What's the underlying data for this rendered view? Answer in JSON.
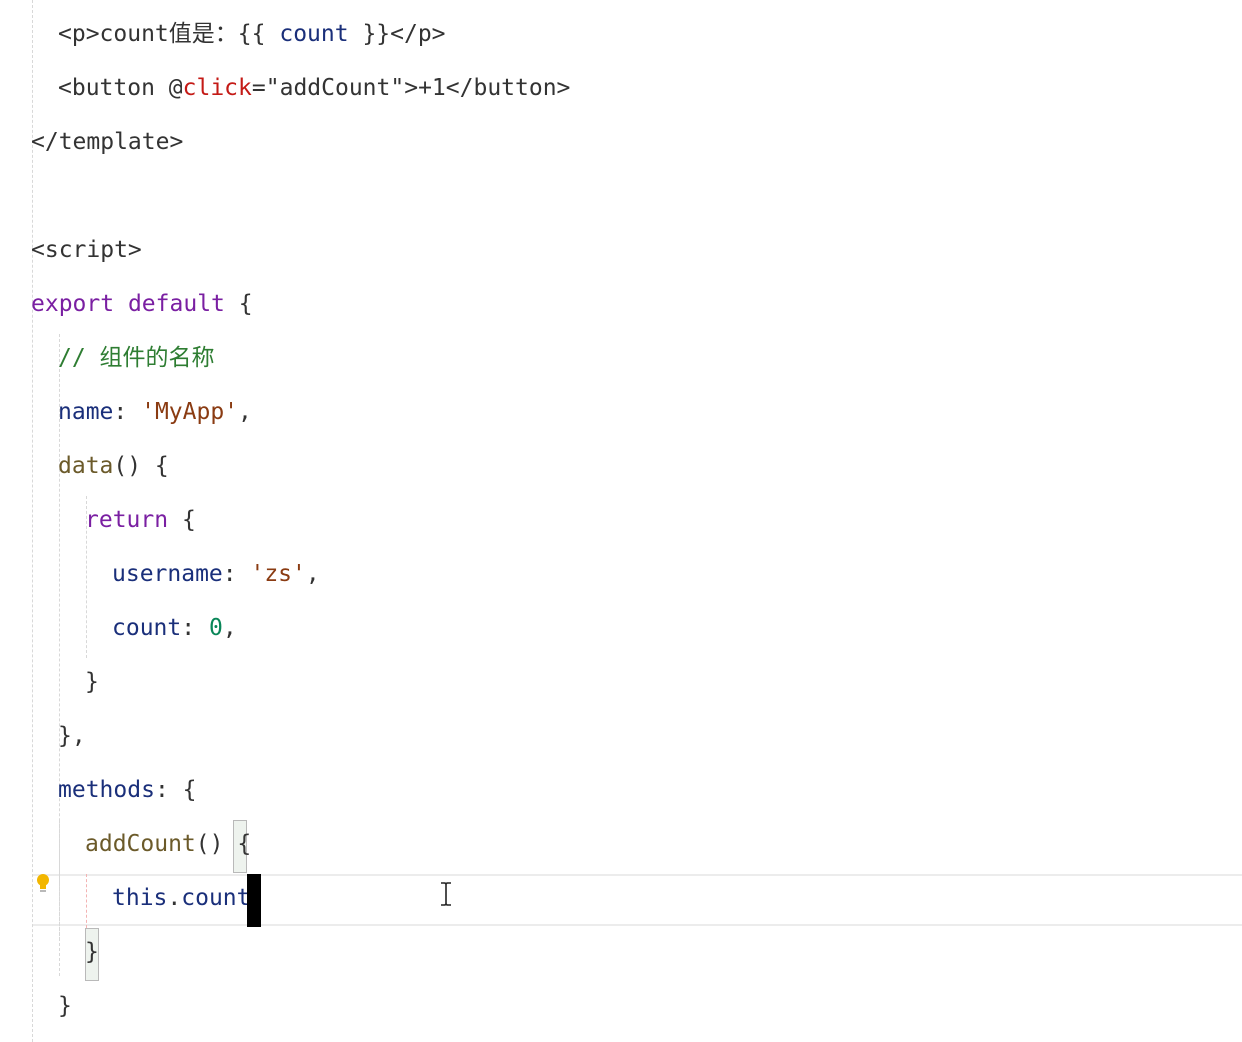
{
  "editor": {
    "language": "vue",
    "cursor": {
      "line": 17,
      "after_text": "this.count"
    },
    "lines": [
      {
        "indent": 1,
        "tokens": [
          {
            "t": "<p>",
            "c": "tag"
          },
          {
            "t": "count值是：",
            "c": "text"
          },
          {
            "t": "{{ ",
            "c": "text"
          },
          {
            "t": "count",
            "c": "var"
          },
          {
            "t": " }}",
            "c": "text"
          },
          {
            "t": "</p>",
            "c": "tag"
          }
        ]
      },
      {
        "indent": 1,
        "tokens": [
          {
            "t": "<button ",
            "c": "tag"
          },
          {
            "t": "@",
            "c": "text"
          },
          {
            "t": "click",
            "c": "attr"
          },
          {
            "t": "=",
            "c": "text"
          },
          {
            "t": "\"addCount\"",
            "c": "str"
          },
          {
            "t": ">+1",
            "c": "text"
          },
          {
            "t": "</button>",
            "c": "tag"
          }
        ]
      },
      {
        "indent": 0,
        "tokens": [
          {
            "t": "</template>",
            "c": "tag"
          }
        ]
      },
      {
        "indent": 0,
        "tokens": []
      },
      {
        "indent": 0,
        "tokens": [
          {
            "t": "<script>",
            "c": "tag"
          }
        ]
      },
      {
        "indent": 0,
        "tokens": [
          {
            "t": "export",
            "c": "kw"
          },
          {
            "t": " ",
            "c": "punc"
          },
          {
            "t": "default",
            "c": "kw"
          },
          {
            "t": " {",
            "c": "punc"
          }
        ]
      },
      {
        "indent": 1,
        "tokens": [
          {
            "t": "// 组件的名称",
            "c": "comment"
          }
        ]
      },
      {
        "indent": 1,
        "tokens": [
          {
            "t": "name",
            "c": "prop"
          },
          {
            "t": ": ",
            "c": "punc"
          },
          {
            "t": "'MyApp'",
            "c": "jsstr"
          },
          {
            "t": ",",
            "c": "punc"
          }
        ]
      },
      {
        "indent": 1,
        "tokens": [
          {
            "t": "data",
            "c": "fn"
          },
          {
            "t": "() {",
            "c": "punc"
          }
        ]
      },
      {
        "indent": 2,
        "tokens": [
          {
            "t": "return",
            "c": "kw"
          },
          {
            "t": " {",
            "c": "punc"
          }
        ]
      },
      {
        "indent": 3,
        "tokens": [
          {
            "t": "username",
            "c": "prop"
          },
          {
            "t": ": ",
            "c": "punc"
          },
          {
            "t": "'zs'",
            "c": "jsstr"
          },
          {
            "t": ",",
            "c": "punc"
          }
        ]
      },
      {
        "indent": 3,
        "tokens": [
          {
            "t": "count",
            "c": "prop"
          },
          {
            "t": ": ",
            "c": "punc"
          },
          {
            "t": "0",
            "c": "num"
          },
          {
            "t": ",",
            "c": "punc"
          }
        ]
      },
      {
        "indent": 2,
        "tokens": [
          {
            "t": "}",
            "c": "punc"
          }
        ]
      },
      {
        "indent": 1,
        "tokens": [
          {
            "t": "},",
            "c": "punc"
          }
        ]
      },
      {
        "indent": 1,
        "tokens": [
          {
            "t": "methods",
            "c": "prop"
          },
          {
            "t": ": {",
            "c": "punc"
          }
        ]
      },
      {
        "indent": 2,
        "tokens": [
          {
            "t": "addCount",
            "c": "fn"
          },
          {
            "t": "() ",
            "c": "punc"
          },
          {
            "t": "{",
            "c": "punc"
          }
        ]
      },
      {
        "indent": 3,
        "tokens": [
          {
            "t": "this",
            "c": "var"
          },
          {
            "t": ".",
            "c": "punc"
          },
          {
            "t": "count",
            "c": "var"
          }
        ]
      },
      {
        "indent": 2,
        "tokens": [
          {
            "t": "}",
            "c": "punc"
          }
        ]
      },
      {
        "indent": 1,
        "tokens": [
          {
            "t": "}",
            "c": "punc"
          }
        ]
      }
    ]
  },
  "icons": {
    "lightbulb": "lightbulb-icon",
    "text_cursor": "ibeam-cursor-icon"
  },
  "colors": {
    "keyword": "#7a1fa2",
    "property": "#1a2f7a",
    "string": "#8a3b12",
    "number": "#098658",
    "function": "#6b5a2a",
    "comment": "#2e7d32",
    "attribute": "#c41a16",
    "hint": "#f2b600"
  }
}
